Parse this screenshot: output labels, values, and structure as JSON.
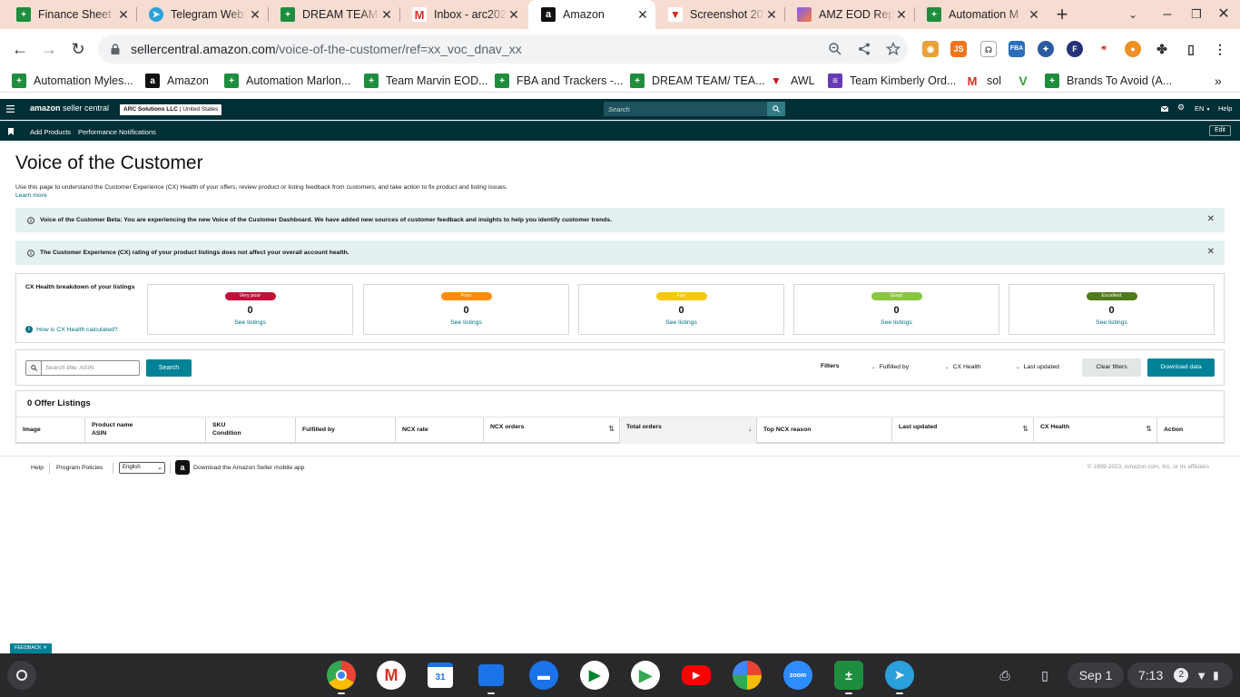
{
  "browser": {
    "tabs": [
      {
        "title": "Finance Sheet",
        "icon": "google-sheets-icon"
      },
      {
        "title": "Telegram Web",
        "icon": "telegram-icon"
      },
      {
        "title": "DREAM TEAM/",
        "icon": "google-sheets-icon"
      },
      {
        "title": "Inbox - arc202",
        "icon": "gmail-icon"
      },
      {
        "title": "Amazon",
        "icon": "amazon-icon",
        "active": true
      },
      {
        "title": "Screenshot 20",
        "icon": "screenshot-icon"
      },
      {
        "title": "AMZ EOD Rep",
        "icon": "clickup-icon"
      },
      {
        "title": "Automation M",
        "icon": "google-sheets-icon"
      }
    ],
    "url_host": "sellercentral.amazon.com",
    "url_path": "/voice-of-the-customer/ref=xx_voc_dnav_xx",
    "bookmarks": [
      {
        "label": "Automation Myles...",
        "icon": "google-sheets-icon"
      },
      {
        "label": "Amazon",
        "icon": "amazon-icon"
      },
      {
        "label": "Automation Marlon...",
        "icon": "google-sheets-icon"
      },
      {
        "label": "Team Marvin EOD...",
        "icon": "google-sheets-icon"
      },
      {
        "label": "FBA and Trackers -...",
        "icon": "google-sheets-icon"
      },
      {
        "label": "DREAM TEAM/ TEA...",
        "icon": "google-sheets-icon"
      },
      {
        "label": "AWL",
        "icon": "awl-icon"
      },
      {
        "label": "Team Kimberly Ord...",
        "icon": "google-forms-icon"
      },
      {
        "label": "sol",
        "icon": "gmail-icon"
      },
      {
        "label": "",
        "icon": "vine-icon"
      },
      {
        "label": "Brands To Avoid (A...",
        "icon": "google-sheets-icon"
      }
    ]
  },
  "seller_central": {
    "logo_bold": "amazon",
    "logo_rest": " seller central",
    "account": "ARC Solutions LLC",
    "account_region": " | United States",
    "search_placeholder": "Search",
    "lang": "EN",
    "help": "Help",
    "sub_nav": [
      "Add Products",
      "Performance Notifications"
    ],
    "edit": "Edit"
  },
  "page": {
    "title": "Voice of the Customer",
    "description": "Use this page to understand the Customer Experience (CX) Health of your offers, review product or listing feedback from customers, and take action to fix product and listing issues.",
    "learn_more": "Learn more",
    "alert_beta": "Voice of the Customer Beta: You are experiencing the new Voice of the Customer Dashboard. We have added new sources of customer feedback and insights to help you identify customer trends.",
    "alert_rating": "The Customer Experience (CX) rating of your product listings does not affect your overall account health."
  },
  "cx_health": {
    "title": "CX Health breakdown of your listings",
    "how_link": "How is CX Health calculated?",
    "see_listings": "See listings",
    "cards": [
      {
        "label": "Very poor",
        "count": "0",
        "color": "#c40f3a"
      },
      {
        "label": "Poor",
        "count": "0",
        "color": "#ff8c00"
      },
      {
        "label": "Fair",
        "count": "0",
        "color": "#f6c800"
      },
      {
        "label": "Good",
        "count": "0",
        "color": "#8ac640"
      },
      {
        "label": "Excellent",
        "count": "0",
        "color": "#4e7a1a"
      }
    ]
  },
  "filters": {
    "search_placeholder": "Search title, ASIN",
    "search_button": "Search",
    "label": "Filters",
    "dropdowns": [
      "Fulfilled by",
      "CX Health",
      "Last updated"
    ],
    "clear": "Clear filters",
    "download": "Download data"
  },
  "listings": {
    "header": "0 Offer Listings",
    "columns": [
      {
        "line1": "Image",
        "line2": ""
      },
      {
        "line1": "Product name",
        "line2": "ASIN"
      },
      {
        "line1": "SKU",
        "line2": "Condition"
      },
      {
        "line1": "Fulfilled by",
        "line2": ""
      },
      {
        "line1": "NCX rate",
        "line2": ""
      },
      {
        "line1": "NCX orders",
        "line2": ""
      },
      {
        "line1": "Total orders",
        "line2": ""
      },
      {
        "line1": "Top NCX reason",
        "line2": ""
      },
      {
        "line1": "Last updated",
        "line2": ""
      },
      {
        "line1": "CX Health",
        "line2": ""
      },
      {
        "line1": "Action",
        "line2": ""
      }
    ]
  },
  "footer": {
    "help": "Help",
    "policies": "Program Policies",
    "language": "English",
    "app": "Download the Amazon Seller mobile app",
    "copyright": "© 1999-2023, Amazon.com, Inc. or its affiliates"
  },
  "feedback": "FEEDBACK",
  "shelf": {
    "date": "Sep 1",
    "time": "7:13",
    "notifications": "2",
    "apps": [
      "chrome-icon",
      "gmail-icon",
      "calendar-icon",
      "files-icon",
      "chat-icon",
      "meet-icon",
      "play-store-icon",
      "youtube-icon",
      "photos-icon",
      "zoom-icon",
      "calculator-icon",
      "telegram-icon"
    ]
  }
}
